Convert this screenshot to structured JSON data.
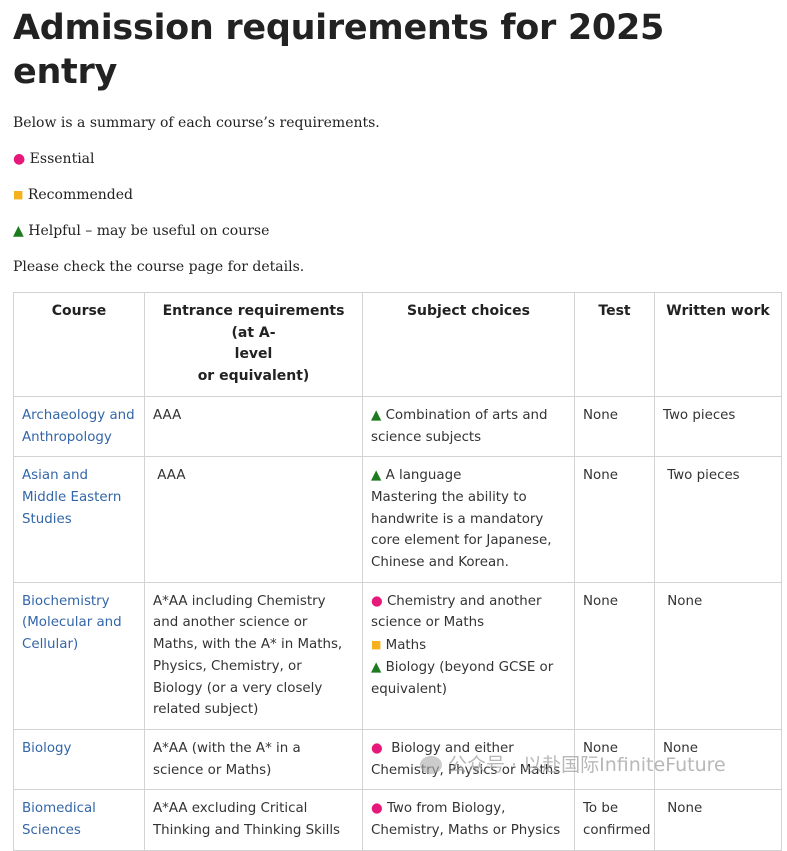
{
  "title": "Admission requirements for 2025 entry",
  "intro": "Below is a summary of each course’s requirements.",
  "legend": {
    "essential": {
      "symbol": "●",
      "label": "Essential",
      "color": "#e6197a"
    },
    "recommended": {
      "symbol": "■",
      "label": "Recommended",
      "color": "#f5b21c"
    },
    "helpful": {
      "symbol": "▲",
      "label": "Helpful – may be useful on course",
      "color": "#1e7a1e"
    }
  },
  "check_note": "Please check the course page for details.",
  "table": {
    "headers": {
      "course": "Course",
      "entrance_line1": "Entrance requirements (at A-",
      "entrance_line2": "level",
      "entrance_line3": "or equivalent)",
      "subjects": "Subject choices",
      "test": "Test",
      "written": "Written work"
    },
    "rows": [
      {
        "course": "Archaeology and Anthropology",
        "entrance": "AAA",
        "subjects": [
          {
            "symbol": "▲",
            "text": "Combination of arts and science subjects"
          }
        ],
        "test": "None",
        "written": "Two pieces"
      },
      {
        "course": "Asian and Middle Eastern Studies",
        "entrance": "AAA",
        "subjects": [
          {
            "symbol": "▲",
            "text": "A language"
          },
          {
            "symbol": "",
            "text": "Mastering the ability to handwrite is a mandatory core element for Japanese, Chinese and Korean."
          }
        ],
        "test": "None",
        "written": "Two pieces"
      },
      {
        "course": "Biochemistry (Molecular and Cellular)",
        "entrance": "A*AA including Chemistry and another science or Maths, with the A* in Maths, Physics, Chemistry, or Biology (or a very closely related subject)",
        "subjects": [
          {
            "symbol": "●",
            "text": "Chemistry and another science or Maths"
          },
          {
            "symbol": "■",
            "text": "Maths"
          },
          {
            "symbol": "▲",
            "text": "Biology (beyond GCSE or equivalent)"
          }
        ],
        "test": "None",
        "written": "None"
      },
      {
        "course": "Biology",
        "entrance": "A*AA (with the A* in a science or Maths)",
        "subjects": [
          {
            "symbol": "●",
            "text": "Biology and either Chemistry, Physics or Maths"
          }
        ],
        "test": "None",
        "written": "None"
      },
      {
        "course": "Biomedical Sciences",
        "entrance": "A*AA excluding Critical Thinking and Thinking Skills",
        "subjects": [
          {
            "symbol": "●",
            "text": "Two from Biology, Chemistry, Maths or Physics"
          }
        ],
        "test": "To be confirmed",
        "written": "None"
      }
    ]
  },
  "watermark": "公众号 · 以赴国际InfiniteFuture"
}
